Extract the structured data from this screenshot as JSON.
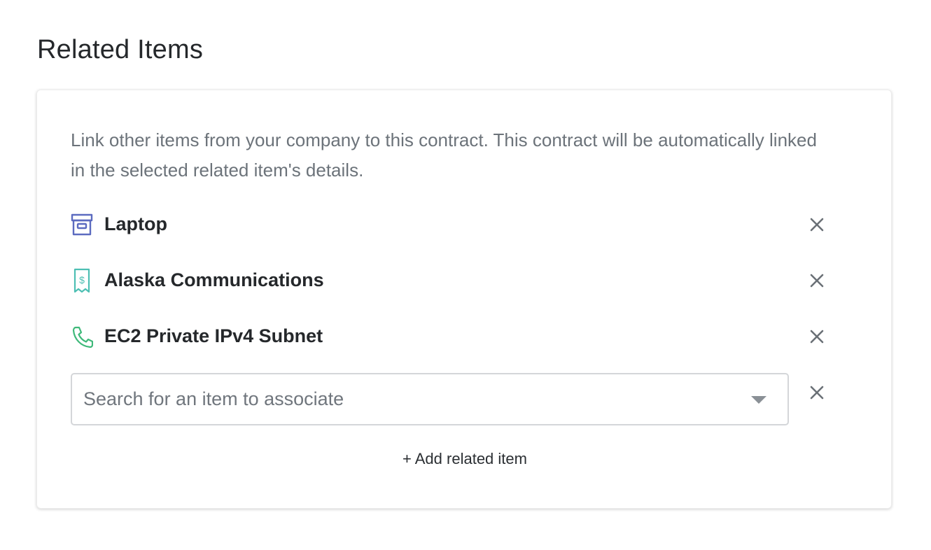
{
  "section": {
    "title": "Related Items"
  },
  "card": {
    "description": "Link other items from your company to this contract. This contract will be automatically linked in the selected related item's details.",
    "items": [
      {
        "label": "Laptop",
        "icon": "archive-box-icon",
        "icon_color": "#5c6bc0"
      },
      {
        "label": "Alaska Communications",
        "icon": "receipt-dollar-icon",
        "icon_color": "#4dbfb3"
      },
      {
        "label": "EC2 Private IPv4 Subnet",
        "icon": "phone-icon",
        "icon_color": "#3fb97a"
      }
    ],
    "search": {
      "placeholder": "Search for an item to associate",
      "value": ""
    },
    "add_link_label": "+ Add related item"
  },
  "colors": {
    "remove_icon": "#6a7076",
    "text_primary": "#25282b",
    "text_secondary": "#6c737a"
  }
}
